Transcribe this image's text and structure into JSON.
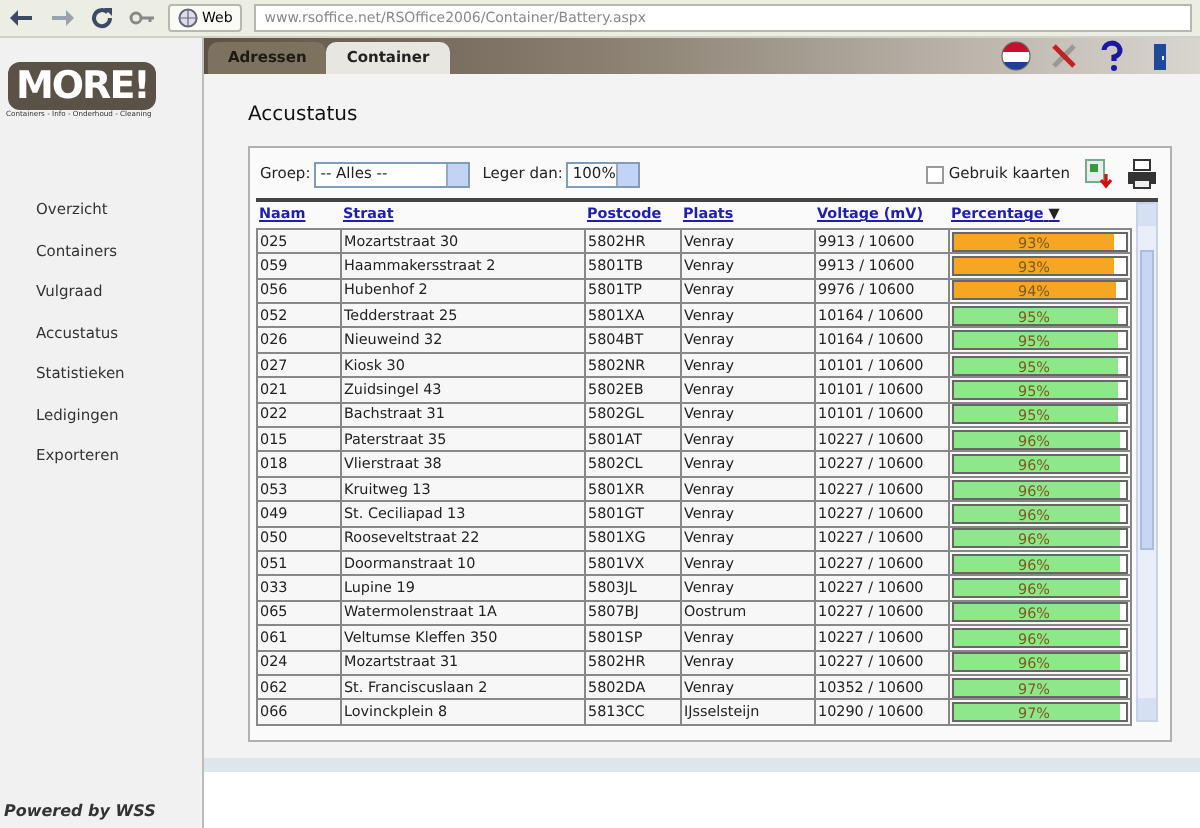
{
  "browser": {
    "web_label": "Web",
    "url": "www.rsoffice.net/RSOffice2006/Container/Battery.aspx"
  },
  "logo": {
    "text": "MORE!",
    "tagline": "Containers - Info - Onderhoud - Cleaning"
  },
  "tabs": [
    {
      "label": "Adressen",
      "selected": false
    },
    {
      "label": "Container",
      "selected": true
    }
  ],
  "sidebar": {
    "items": [
      "Overzicht",
      "Containers",
      "Vulgraad",
      "Accustatus",
      "Statistieken",
      "Ledigingen",
      "Exporteren"
    ],
    "footer": "Powered by WSS"
  },
  "page_title": "Accustatus",
  "filters": {
    "group_label": "Groep:",
    "group_value": "-- Alles --",
    "less_label": "Leger dan:",
    "less_value": "100%",
    "cards_label": "Gebruik kaarten",
    "cards_checked": false
  },
  "table": {
    "columns": [
      "Naam",
      "Straat",
      "Postcode",
      "Plaats",
      "Voltage (mV)",
      "Percentage"
    ],
    "sort_mark": "▼",
    "rows": [
      {
        "naam": "025",
        "straat": "Mozartstraat 30",
        "postcode": "5802HR",
        "plaats": "Venray",
        "voltage": "9913 / 10600",
        "percentage": "93%",
        "level": 0.93,
        "color": "#f5a623"
      },
      {
        "naam": "059",
        "straat": "Haammakersstraat 2",
        "postcode": "5801TB",
        "plaats": "Venray",
        "voltage": "9913 / 10600",
        "percentage": "93%",
        "level": 0.93,
        "color": "#f5a623"
      },
      {
        "naam": "056",
        "straat": "Hubenhof 2",
        "postcode": "5801TP",
        "plaats": "Venray",
        "voltage": "9976 / 10600",
        "percentage": "94%",
        "level": 0.94,
        "color": "#f5a623"
      },
      {
        "naam": "052",
        "straat": "Tedderstraat 25",
        "postcode": "5801XA",
        "plaats": "Venray",
        "voltage": "10164 / 10600",
        "percentage": "95%",
        "level": 0.95,
        "color": "#8ee88a"
      },
      {
        "naam": "026",
        "straat": "Nieuweind 32",
        "postcode": "5804BT",
        "plaats": "Venray",
        "voltage": "10164 / 10600",
        "percentage": "95%",
        "level": 0.95,
        "color": "#8ee88a"
      },
      {
        "naam": "027",
        "straat": "Kiosk 30",
        "postcode": "5802NR",
        "plaats": "Venray",
        "voltage": "10101 / 10600",
        "percentage": "95%",
        "level": 0.95,
        "color": "#8ee88a"
      },
      {
        "naam": "021",
        "straat": "Zuidsingel 43",
        "postcode": "5802EB",
        "plaats": "Venray",
        "voltage": "10101 / 10600",
        "percentage": "95%",
        "level": 0.95,
        "color": "#8ee88a"
      },
      {
        "naam": "022",
        "straat": "Bachstraat 31",
        "postcode": "5802GL",
        "plaats": "Venray",
        "voltage": "10101 / 10600",
        "percentage": "95%",
        "level": 0.95,
        "color": "#8ee88a"
      },
      {
        "naam": "015",
        "straat": "Paterstraat 35",
        "postcode": "5801AT",
        "plaats": "Venray",
        "voltage": "10227 / 10600",
        "percentage": "96%",
        "level": 0.96,
        "color": "#8ee88a"
      },
      {
        "naam": "018",
        "straat": "Vlierstraat 38",
        "postcode": "5802CL",
        "plaats": "Venray",
        "voltage": "10227 / 10600",
        "percentage": "96%",
        "level": 0.96,
        "color": "#8ee88a"
      },
      {
        "naam": "053",
        "straat": "Kruitweg 13",
        "postcode": "5801XR",
        "plaats": "Venray",
        "voltage": "10227 / 10600",
        "percentage": "96%",
        "level": 0.96,
        "color": "#8ee88a"
      },
      {
        "naam": "049",
        "straat": "St. Ceciliapad 13",
        "postcode": "5801GT",
        "plaats": "Venray",
        "voltage": "10227 / 10600",
        "percentage": "96%",
        "level": 0.96,
        "color": "#8ee88a"
      },
      {
        "naam": "050",
        "straat": "Rooseveltstraat 22",
        "postcode": "5801XG",
        "plaats": "Venray",
        "voltage": "10227 / 10600",
        "percentage": "96%",
        "level": 0.96,
        "color": "#8ee88a"
      },
      {
        "naam": "051",
        "straat": "Doormanstraat 10",
        "postcode": "5801VX",
        "plaats": "Venray",
        "voltage": "10227 / 10600",
        "percentage": "96%",
        "level": 0.96,
        "color": "#8ee88a"
      },
      {
        "naam": "033",
        "straat": "Lupine 19",
        "postcode": "5803JL",
        "plaats": "Venray",
        "voltage": "10227 / 10600",
        "percentage": "96%",
        "level": 0.96,
        "color": "#8ee88a"
      },
      {
        "naam": "065",
        "straat": "Watermolenstraat 1A",
        "postcode": "5807BJ",
        "plaats": "Oostrum",
        "voltage": "10227 / 10600",
        "percentage": "96%",
        "level": 0.96,
        "color": "#8ee88a"
      },
      {
        "naam": "061",
        "straat": "Veltumse Kleffen 350",
        "postcode": "5801SP",
        "plaats": "Venray",
        "voltage": "10227 / 10600",
        "percentage": "96%",
        "level": 0.96,
        "color": "#8ee88a"
      },
      {
        "naam": "024",
        "straat": "Mozartstraat 31",
        "postcode": "5802HR",
        "plaats": "Venray",
        "voltage": "10227 / 10600",
        "percentage": "96%",
        "level": 0.96,
        "color": "#8ee88a"
      },
      {
        "naam": "062",
        "straat": "St. Franciscuslaan 2",
        "postcode": "5802DA",
        "plaats": "Venray",
        "voltage": "10352 / 10600",
        "percentage": "97%",
        "level": 0.97,
        "color": "#8ee88a"
      },
      {
        "naam": "066",
        "straat": "Lovinckplein 8",
        "postcode": "5813CC",
        "plaats": "IJsselsteijn",
        "voltage": "10290 / 10600",
        "percentage": "97%",
        "level": 0.97,
        "color": "#8ee88a"
      }
    ]
  }
}
